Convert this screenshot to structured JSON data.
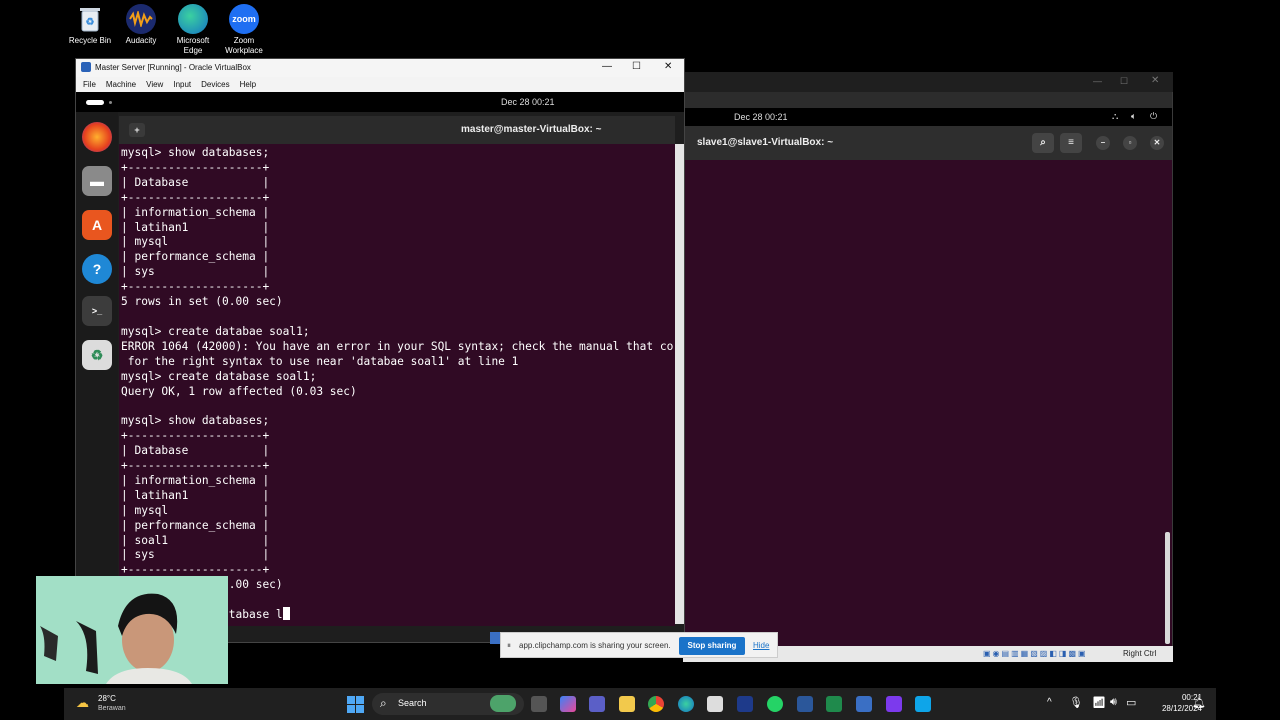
{
  "desktop": {
    "icons": [
      {
        "label": "Recycle Bin",
        "name": "recycle-bin"
      },
      {
        "label": "Audacity",
        "name": "audacity"
      },
      {
        "label": "Microsoft Edge",
        "name": "microsoft-edge"
      },
      {
        "label": "Zoom Workplace",
        "name": "zoom-workplace"
      }
    ],
    "zoom_glyph": "zoom"
  },
  "slave_vm": {
    "clock": "Dec 28  00:21",
    "terminal_title": "slave1@slave1-VirtualBox: ~",
    "status_right": "Right Ctrl"
  },
  "master_vm": {
    "window_title": "Master Server [Running] - Oracle VirtualBox",
    "menu": [
      "File",
      "Machine",
      "View",
      "Input",
      "Devices",
      "Help"
    ],
    "clock": "Dec 28  00:21",
    "terminal_title": "master@master-VirtualBox: ~",
    "terminal_lines": [
      "mysql> show databases;",
      "+--------------------+",
      "| Database           |",
      "+--------------------+",
      "| information_schema |",
      "| latihan1           |",
      "| mysql              |",
      "| performance_schema |",
      "| sys                |",
      "+--------------------+",
      "5 rows in set (0.00 sec)",
      "",
      "mysql> create databae soal1;",
      "ERROR 1064 (42000): You have an error in your SQL syntax; check the manual that co",
      " for the right syntax to use near 'databae soal1' at line 1",
      "mysql> create database soal1;",
      "Query OK, 1 row affected (0.03 sec)",
      "",
      "mysql> show databases;",
      "+--------------------+",
      "| Database           |",
      "+--------------------+",
      "| information_schema |",
      "| latihan1           |",
      "| mysql              |",
      "| performance_schema |",
      "| soal1              |",
      "| sys                |",
      "+--------------------+",
      "                .00 sec)",
      "",
      "                tabase l"
    ]
  },
  "share_banner": {
    "message": "app.clipchamp.com is sharing your screen.",
    "stop_label": "Stop sharing",
    "hide_label": "Hide"
  },
  "taskbar": {
    "weather_temp": "28°C",
    "weather_desc": "Berawan",
    "search_label": "Search",
    "time": "00:21",
    "date": "28/12/2024"
  },
  "colors": {
    "terminal_bg": "#300a24",
    "accent_blue": "#1a73c9"
  }
}
